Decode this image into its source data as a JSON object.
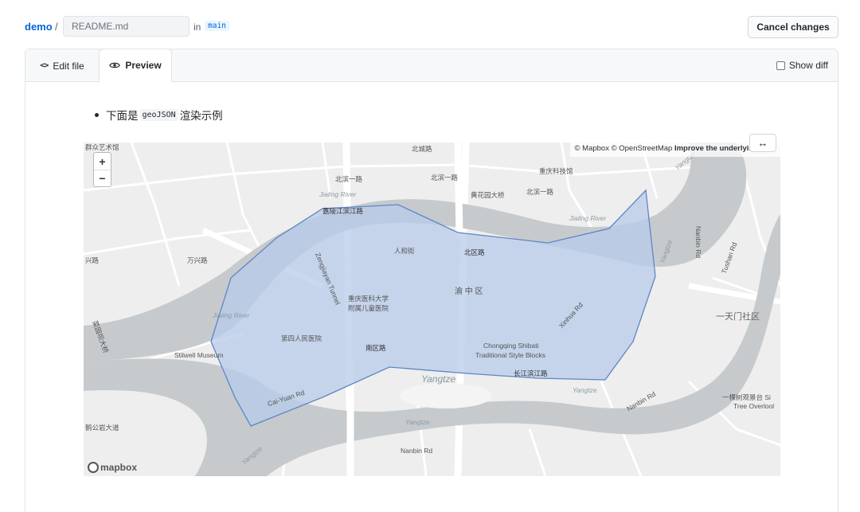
{
  "header": {
    "repo": "demo",
    "separator": "/",
    "filename_value": "README.md",
    "in_text": "in",
    "branch": "main",
    "cancel_label": "Cancel changes"
  },
  "tabs": {
    "edit_icon": "<>",
    "edit_label": "Edit file",
    "preview_label": "Preview",
    "show_diff_label": "Show diff"
  },
  "preview": {
    "text_before": "下面是",
    "code": "geoJSON",
    "text_after": "渲染示例"
  },
  "map": {
    "zoom_in": "+",
    "zoom_out": "−",
    "attribution_plain": "© Mapbox © OpenStreetMap",
    "attribution_bold": "Improve the underlying",
    "expand_icon": "↔",
    "logo_text": "mapbox",
    "colors": {
      "land": "#eeeeee",
      "water": "#c6cacd",
      "polygon_fill": "#b7cbe9",
      "polygon_stroke": "#5e86c3"
    },
    "labels": [
      {
        "text": "群众艺术馆",
        "cls": ""
      },
      {
        "text": "北城路",
        "cls": ""
      },
      {
        "text": "重庆科技馆",
        "cls": ""
      },
      {
        "text": "北滨一路",
        "cls": ""
      },
      {
        "text": "北滨一路",
        "cls": ""
      },
      {
        "text": "北滨一路",
        "cls": ""
      },
      {
        "text": "Jialing River",
        "cls": "water"
      },
      {
        "text": "嘉陵江滨江路",
        "cls": "dark"
      },
      {
        "text": "黄花园大桥",
        "cls": ""
      },
      {
        "text": "Jialing River",
        "cls": "water"
      },
      {
        "text": "Jialing River",
        "cls": "water"
      },
      {
        "text": "万兴路",
        "cls": ""
      },
      {
        "text": "兴路",
        "cls": ""
      },
      {
        "text": "人和街",
        "cls": ""
      },
      {
        "text": "北区路",
        "cls": "dark"
      },
      {
        "text": "渝 中 区",
        "cls": "district"
      },
      {
        "text": "Zengjiayan Tunnel",
        "cls": ""
      },
      {
        "text": "重庆医科大学",
        "cls": ""
      },
      {
        "text": "附属儿童医院",
        "cls": ""
      },
      {
        "text": "第四人民医院",
        "cls": ""
      },
      {
        "text": "南区路",
        "cls": "dark"
      },
      {
        "text": "Stilwell Museum",
        "cls": ""
      },
      {
        "text": "Chongqing Shibati",
        "cls": ""
      },
      {
        "text": "Traditional Style Blocks",
        "cls": ""
      },
      {
        "text": "长江滨江路",
        "cls": "dark"
      },
      {
        "text": "Yangtze",
        "cls": "water"
      },
      {
        "text": "Cai-Yuan Rd",
        "cls": ""
      },
      {
        "text": "Xinhua Rd",
        "cls": ""
      },
      {
        "text": "Nanbin Rd",
        "cls": ""
      },
      {
        "text": "Nanbin Rd",
        "cls": ""
      },
      {
        "text": "Nanbin Rd",
        "cls": ""
      },
      {
        "text": "Tushan Rd",
        "cls": ""
      },
      {
        "text": "一天门社区",
        "cls": "big"
      },
      {
        "text": "一棵树观景台 Si",
        "cls": ""
      },
      {
        "text": "Tree Overlool",
        "cls": ""
      },
      {
        "text": "Yangtze",
        "cls": "water"
      },
      {
        "text": "Yangtze",
        "cls": "water"
      },
      {
        "text": "Yangtze",
        "cls": "water"
      },
      {
        "text": "Yangtze",
        "cls": "water"
      },
      {
        "text": "菜园坝大桥",
        "cls": ""
      },
      {
        "text": "鹅公岩大道",
        "cls": ""
      },
      {
        "text": "Yangtze",
        "cls": "water"
      }
    ]
  }
}
